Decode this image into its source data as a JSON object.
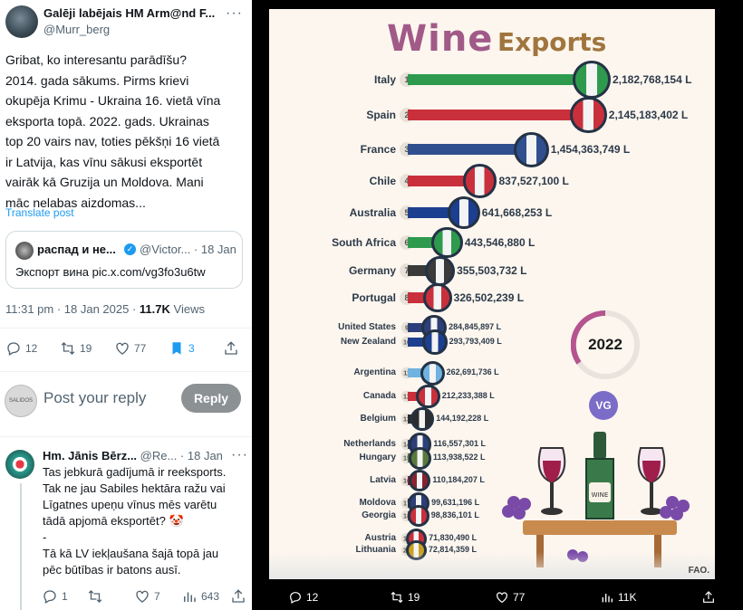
{
  "tweet": {
    "author_name": "Galēji labējais HM Arm@nd F...",
    "author_handle": "@Murr_berg",
    "more_glyph": "···",
    "text": "Gribat, ko interesantu parādīšu?\n2014. gada sākums. Pirms krievi\nokupēja Krimu -  Ukraina 16. vietā vīna\neksporta topā. 2022. gads. Ukrainas\ntop 20 vairs nav, toties pēkšņi 16 vietā\nir  Latvija, kas vīnu sākusi eksportēt\nvairāk kā Gruzija un Moldova. Mani\nmāc nelabas aizdomas...",
    "translate_label": "Translate post",
    "timestamp": "11:31 pm · 18 Jan 2025 · ",
    "views_count": "11.7K",
    "views_label": " Views"
  },
  "quote": {
    "name": "распад и не...",
    "verified_glyph": "✓",
    "handle_date": "@Victor... · 18 Jan",
    "text": "Экспорт вина pic.x.com/vg3fo3u6tw"
  },
  "actions": {
    "replies": "12",
    "reposts": "19",
    "likes": "77",
    "bookmarks": "3"
  },
  "reply_box": {
    "avatar_text": "SALIDOS",
    "placeholder": "Post your reply",
    "button_label": "Reply"
  },
  "reply": {
    "name": "Hm. Jānis Bērz...",
    "handle_date": "@Re... · 18 Jan",
    "more_glyph": "···",
    "text": "Tas jebkurā gadījumā ir reeksports.\nTak ne jau Sabiles hektāra ražu vai\nLīgatnes upeņu vīnus mēs varētu\ntādā apjomā eksportēt? 🤡\n-\nTā kā LV iekļaušana šajā topā jau\npēc būtības ir batons ausī.",
    "replies": "1",
    "likes": "7",
    "views": "643"
  },
  "video": {
    "title_wine": "Wine",
    "title_exports": "Exports",
    "year": "2022",
    "badge": "VG",
    "source": "FAO.",
    "replies": "12",
    "reposts": "19",
    "likes": "77",
    "views": "11K"
  },
  "chart_data": {
    "type": "bar",
    "title": "Wine Exports",
    "year": "2022",
    "unit": "L",
    "categories": [
      "Italy",
      "Spain",
      "France",
      "Chile",
      "Australia",
      "South Africa",
      "Germany",
      "Portugal",
      "United States",
      "New Zealand",
      "Argentina",
      "Canada",
      "Belgium",
      "Netherlands",
      "Hungary",
      "Latvia",
      "Moldova",
      "Georgia",
      "Austria",
      "Lithuania"
    ],
    "ranks": [
      "1",
      "2",
      "3",
      "4",
      "5",
      "6",
      "7",
      "8",
      "9",
      "10",
      "11",
      "12",
      "13",
      "14",
      "15",
      "16",
      "17",
      "18",
      "19",
      "20"
    ],
    "value_labels": [
      "2,182,768,154 L",
      "2,145,183,402 L",
      "1,454,363,749 L",
      "837,527,100 L",
      "641,668,253 L",
      "443,546,880 L",
      "355,503,732 L",
      "326,502,239 L",
      "284,845,897 L",
      "293,793,409 L",
      "262,691,736 L",
      "212,233,388 L",
      "144,192,228 L",
      "116,557,301 L",
      "113,938,522 L",
      "110,184,207 L",
      "99,631,196 L",
      "98,836,101 L",
      "71,830,490 L",
      "72,814,359 L"
    ],
    "values": [
      2182768154,
      2145183402,
      1454363749,
      837527100,
      641668253,
      443546880,
      355503732,
      326502239,
      284845897,
      293793409,
      262691736,
      212233388,
      144192228,
      116557301,
      113938522,
      110184207,
      99631196,
      98836101,
      71830490,
      72814359
    ],
    "bar_colors": [
      "#2e9a4d",
      "#c9303c",
      "#2f4f8f",
      "#c9303c",
      "#1d3f8f",
      "#2e9a4d",
      "#3a3a3a",
      "#c9303c",
      "#2d3f7a",
      "#1d3f8f",
      "#6fb3e0",
      "#c9303c",
      "#2d2d2d",
      "#2d3f7a",
      "#5a7a3a",
      "#8a2230",
      "#2d3f7a",
      "#c9303c",
      "#c9303c",
      "#c9a020"
    ]
  }
}
